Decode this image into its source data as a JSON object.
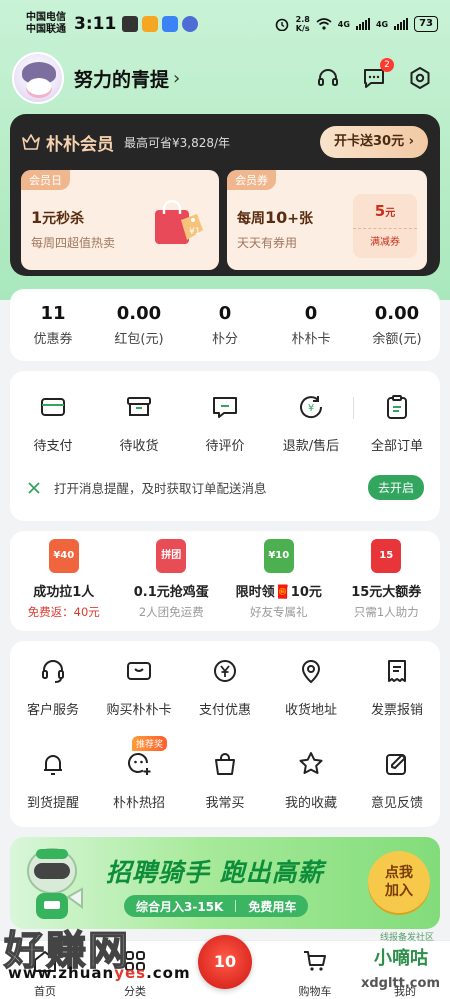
{
  "status_bar": {
    "carrier_1": "中国电信",
    "carrier_2": "中国联通",
    "time": "3:11",
    "net_speed_value": "2.8",
    "net_speed_unit": "K/s",
    "signal_1": "4G",
    "signal_2": "4G",
    "battery": "73"
  },
  "header": {
    "user_name": "努力的青提",
    "chevron": "›",
    "message_badge": "2"
  },
  "membership": {
    "title": "朴朴会员",
    "savings": "最高可省¥3,828/年",
    "open_button": "开卡送30元 ›",
    "box1": {
      "tag": "会员日",
      "title_num": "1",
      "title_rest": "元秒杀",
      "desc": "每周四超值热卖"
    },
    "box2": {
      "tag": "会员券",
      "title_pre": "每周",
      "title_num": "10",
      "title_rest": "+张",
      "desc": "天天有券用",
      "coupon_value": "5",
      "coupon_unit": "元",
      "coupon_label": "满减券"
    }
  },
  "assets": [
    {
      "value": "11",
      "label": "优惠券"
    },
    {
      "value": "0.00",
      "label": "红包(元)"
    },
    {
      "value": "0",
      "label": "朴分"
    },
    {
      "value": "0",
      "label": "朴朴卡"
    },
    {
      "value": "0.00",
      "label": "余额(元)"
    }
  ],
  "orders": [
    {
      "label": "待支付",
      "icon": "wallet-icon"
    },
    {
      "label": "待收货",
      "icon": "box-icon"
    },
    {
      "label": "待评价",
      "icon": "comment-icon"
    },
    {
      "label": "退款/售后",
      "icon": "refund-icon"
    },
    {
      "label": "全部订单",
      "icon": "clipboard-icon"
    }
  ],
  "notice": {
    "text": "打开消息提醒，及时获取订单配送消息",
    "button": "去开启"
  },
  "promos": [
    {
      "icon_text": "¥40",
      "title": "成功拉1人",
      "sub": "免费返：40元",
      "color": "#f0653e"
    },
    {
      "icon_text": "拼团",
      "title": "0.1元抢鸡蛋",
      "sub": "2人团免运费",
      "color": "#e84c55"
    },
    {
      "icon_text": "¥10",
      "title": "限时领🧧10元",
      "sub": "好友专属礼",
      "color": "#4cb050"
    },
    {
      "icon_text": "15",
      "title": "15元大额券",
      "sub": "只需1人助力",
      "color": "#e8353a"
    }
  ],
  "services": [
    {
      "label": "客户服务",
      "icon": "headset-icon"
    },
    {
      "label": "购买朴朴卡",
      "icon": "card-icon"
    },
    {
      "label": "支付优惠",
      "icon": "yen-icon"
    },
    {
      "label": "收货地址",
      "icon": "location-icon"
    },
    {
      "label": "发票报销",
      "icon": "invoice-icon"
    },
    {
      "label": "到货提醒",
      "icon": "bell-icon"
    },
    {
      "label": "朴朴热招",
      "icon": "recruit-icon",
      "tag": "推荐奖"
    },
    {
      "label": "我常买",
      "icon": "bag-icon"
    },
    {
      "label": "我的收藏",
      "icon": "star-icon"
    },
    {
      "label": "意见反馈",
      "icon": "feedback-icon"
    }
  ],
  "banner": {
    "title": "招聘骑手 跑出高薪",
    "pill_1": "综合月入3-15K",
    "pill_2": "免费用车",
    "join_line1": "点我",
    "join_line2": "加入"
  },
  "bottom_nav": [
    {
      "label": "首页"
    },
    {
      "label": "分类"
    },
    {
      "label": ""
    },
    {
      "label": "购物车"
    },
    {
      "label": "我的"
    }
  ],
  "watermark": {
    "left_text": "好赚网",
    "url_pre": "www.zhuan",
    "url_mid": "yes",
    "url_post": ".com",
    "right_small": "线报备发社区",
    "right_text": "小嘀咕",
    "right_url": "xdgltt.com"
  },
  "colors": {
    "brand_green": "#32a55e",
    "member_dark": "#262626",
    "member_gold": "#f7d2b0",
    "badge_red": "#ff3b30"
  }
}
